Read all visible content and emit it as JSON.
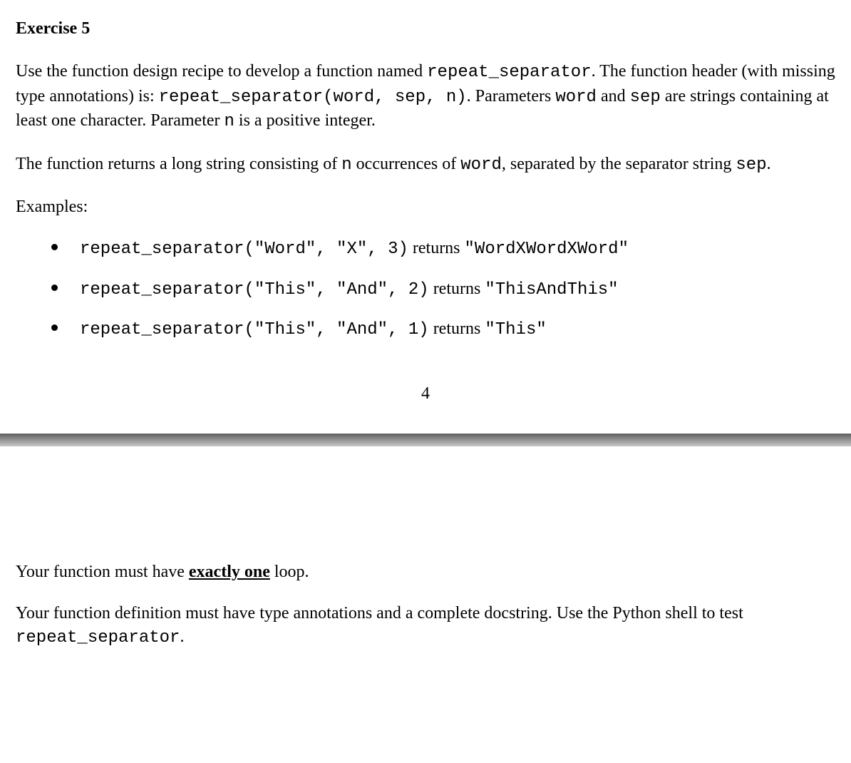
{
  "heading": "Exercise 5",
  "para1": {
    "t1": "Use the function design recipe to develop a function named ",
    "fn_name": "repeat_separator",
    "t2": ". The function header (with missing type annotations) is: ",
    "header_code": "repeat_separator(word, sep, n)",
    "t3": ". Parameters ",
    "p_word": "word",
    "t4": " and ",
    "p_sep": "sep",
    "t5": " are strings containing at least one character. Parameter ",
    "p_n": "n",
    "t6": " is a positive integer."
  },
  "para2": {
    "t1": "The function returns a long string consisting of ",
    "c1": "n",
    "t2": " occurrences of ",
    "c2": "word",
    "t3": ", separated by the separator string ",
    "c3": "sep",
    "t4": "."
  },
  "examples_label": "Examples:",
  "examples": [
    {
      "call": "repeat_separator(\"Word\", \"X\", 3)",
      "returns_word": " returns ",
      "result": "\"WordXWordXWord\""
    },
    {
      "call": "repeat_separator(\"This\", \"And\", 2)",
      "returns_word": " returns ",
      "result": "\"ThisAndThis\""
    },
    {
      "call": "repeat_separator(\"This\", \"And\", 1)",
      "returns_word": " returns ",
      "result": "\"This\""
    }
  ],
  "page_number": "4",
  "bottom": {
    "req1_a": "Your function must have ",
    "req1_b": "exactly one",
    "req1_c": " loop.",
    "req2_a": "Your function definition must have type annotations and a complete docstring. Use the Python shell to test ",
    "req2_code": "repeat_separator",
    "req2_b": "."
  }
}
